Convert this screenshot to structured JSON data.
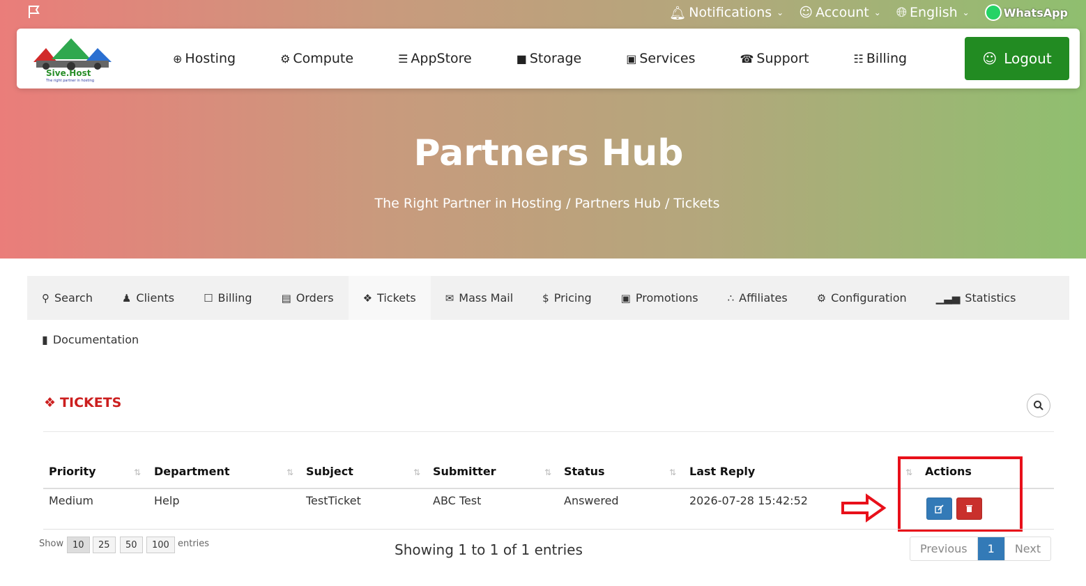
{
  "topbar": {
    "notifications": "Notifications",
    "account": "Account",
    "language": "English",
    "whatsapp": "WhatsApp"
  },
  "brand": {
    "name": "Sive.Host",
    "tagline": "The right partner in hosting"
  },
  "mainnav": {
    "items": [
      "Hosting",
      "Compute",
      "AppStore",
      "Storage",
      "Services",
      "Support",
      "Billing"
    ],
    "logout": "Logout"
  },
  "hero": {
    "title": "Partners Hub",
    "crumbs": [
      "The Right Partner in Hosting",
      "/ Partners Hub",
      "/ Tickets"
    ]
  },
  "tabs": [
    "Search",
    "Clients",
    "Billing",
    "Orders",
    "Tickets",
    "Mass Mail",
    "Pricing",
    "Promotions",
    "Affiliates",
    "Configuration",
    "Statistics"
  ],
  "doc_tab": "Documentation",
  "section": {
    "title": "TICKETS"
  },
  "table": {
    "columns": [
      "Priority",
      "Department",
      "Subject",
      "Submitter",
      "Status",
      "Last Reply",
      "Actions"
    ],
    "rows": [
      {
        "priority": "Medium",
        "department": "Help",
        "subject": "TestTicket",
        "submitter": "ABC Test",
        "status": "Answered",
        "last_reply": "2026-07-28 15:42:52"
      }
    ]
  },
  "length": {
    "show": "Show",
    "options": [
      "10",
      "25",
      "50",
      "100"
    ],
    "entries": "entries"
  },
  "info": "Showing 1 to 1 of 1 entries",
  "pager": {
    "previous": "Previous",
    "current": "1",
    "next": "Next"
  },
  "colors": {
    "accent_red": "#cc1f1f",
    "logout_green": "#228b22",
    "edit_blue": "#337ab7",
    "delete_red": "#c9302c",
    "highlight": "#e8101a"
  }
}
